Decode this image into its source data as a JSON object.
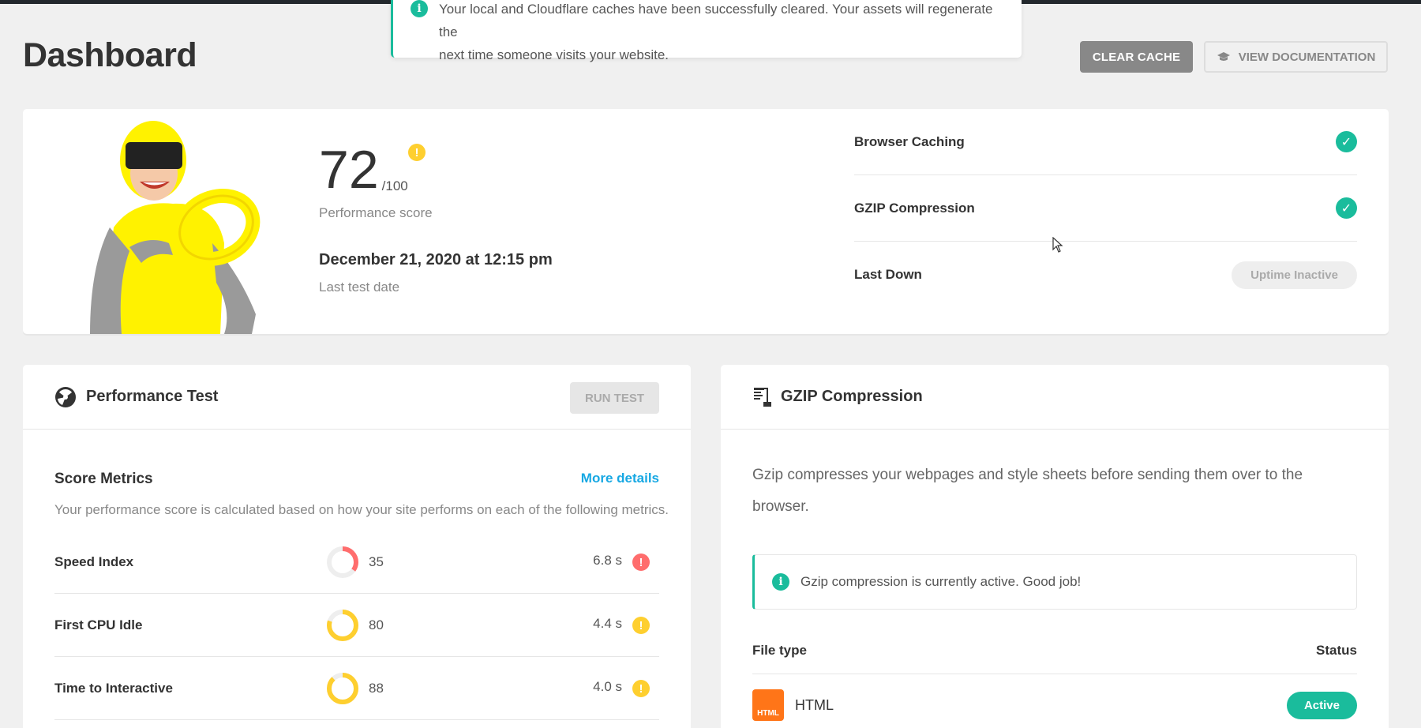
{
  "page": {
    "title": "Dashboard",
    "clear_cache_label": "CLEAR CACHE",
    "view_docs_label": "VIEW DOCUMENTATION"
  },
  "notice": {
    "line1": "Your local and Cloudflare caches have been successfully cleared. Your assets will regenerate the",
    "line2": "next time someone visits your website."
  },
  "summary": {
    "score": "72",
    "score_max": "/100",
    "score_label": "Performance score",
    "test_date": "December 21, 2020 at 12:15 pm",
    "test_date_label": "Last test date",
    "status_items": [
      {
        "label": "Browser Caching",
        "state": "check"
      },
      {
        "label": "GZIP Compression",
        "state": "check"
      },
      {
        "label": "Last Down",
        "pill": "Uptime Inactive"
      }
    ]
  },
  "performance_test": {
    "title": "Performance Test",
    "run_test_label": "RUN TEST",
    "metrics_title": "Score Metrics",
    "more_details_label": "More details",
    "description": "Your performance score is calculated based on how your site performs on each of the following metrics.",
    "metrics": [
      {
        "name": "Speed Index",
        "score": "35",
        "time": "6.8 s",
        "level": "error",
        "color": "#ff6d6d"
      },
      {
        "name": "First CPU Idle",
        "score": "80",
        "time": "4.4 s",
        "level": "warning",
        "color": "#fecf2f"
      },
      {
        "name": "Time to Interactive",
        "score": "88",
        "time": "4.0 s",
        "level": "warning",
        "color": "#fecf2f"
      }
    ]
  },
  "gzip": {
    "title": "GZIP Compression",
    "description": "Gzip compresses your webpages and style sheets before sending them over to the browser.",
    "notice": "Gzip compression is currently active. Good job!",
    "file_type_header": "File type",
    "status_header": "Status",
    "rows": [
      {
        "icon_label": "HTML",
        "name": "HTML",
        "status": "Active"
      }
    ]
  },
  "colors": {
    "accent": "#1abc9c",
    "warning": "#fecf2f",
    "error": "#ff6d6d",
    "link": "#17a8e3"
  }
}
